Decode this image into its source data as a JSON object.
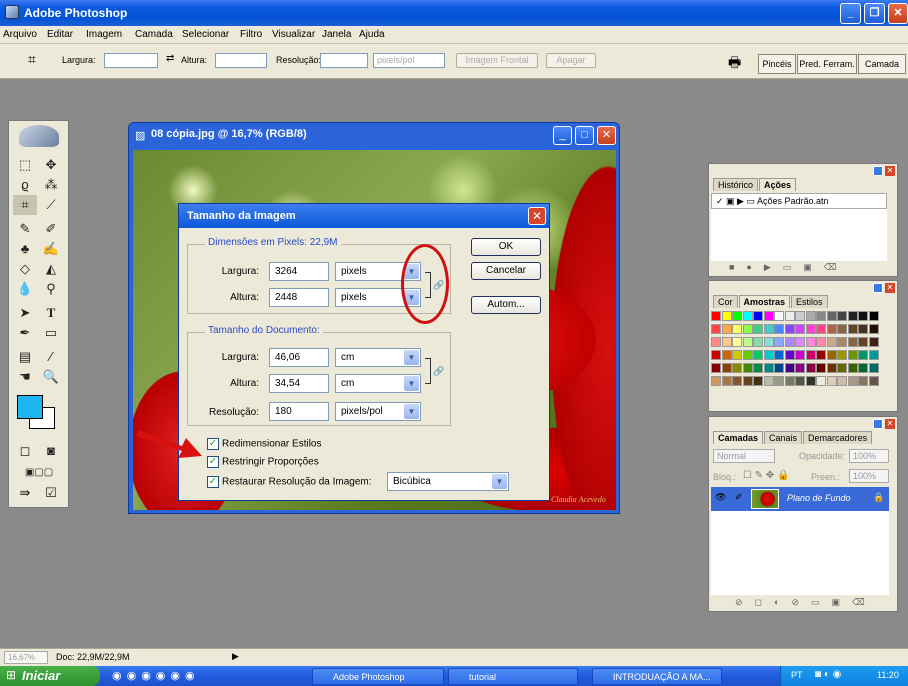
{
  "app": {
    "title": "Adobe Photoshop"
  },
  "menu": [
    "Arquivo",
    "Editar",
    "Imagem",
    "Camada",
    "Selecionar",
    "Filtro",
    "Visualizar",
    "Janela",
    "Ajuda"
  ],
  "options": {
    "largura_label": "Largura:",
    "altura_label": "Altura:",
    "resolucao_label": "Resolução:",
    "unit": "pixels/pol",
    "front_image": "Imagem Frontal",
    "clear": "Apagar",
    "tabs": [
      "Pincéis",
      "Pred. Ferram.",
      "Camada"
    ]
  },
  "document": {
    "title": "08 cópia.jpg @ 16,7% (RGB/8)",
    "watermark": "Claudia Acevedo"
  },
  "dialog": {
    "title": "Tamanho da Imagem",
    "pixel_dims_label": "Dimensões em Pixels: 22,9M",
    "doc_size_label": "Tamanho do Documento:",
    "px_width_label": "Largura:",
    "px_width": "3264",
    "px_width_unit": "pixels",
    "px_height_label": "Altura:",
    "px_height": "2448",
    "px_height_unit": "pixels",
    "doc_width_label": "Largura:",
    "doc_width": "46,06",
    "doc_width_unit": "cm",
    "doc_height_label": "Altura:",
    "doc_height": "34,54",
    "doc_height_unit": "cm",
    "resolution_label": "Resolução:",
    "resolution": "180",
    "resolution_unit": "pixels/pol",
    "ok": "OK",
    "cancel": "Cancelar",
    "auto": "Autom...",
    "chk_scale_styles": "Redimensionar Estilos",
    "chk_constrain": "Restringir Proporções",
    "chk_resample": "Restaurar Resolução da Imagem:",
    "resample_method": "Bicúbica"
  },
  "actions_panel": {
    "tabs": [
      "Histórico",
      "Ações"
    ],
    "item": "Ações Padrão.atn"
  },
  "swatches_panel": {
    "tabs": [
      "Cor",
      "Amostras",
      "Estilos"
    ]
  },
  "layers_panel": {
    "tabs": [
      "Camadas",
      "Canais",
      "Demarcadores"
    ],
    "blend": "Normal",
    "opacity_label": "Opacidade:",
    "opacity": "100%",
    "lock_label": "Bloq.:",
    "fill_label": "Preen.:",
    "fill": "100%",
    "layer_name": "Plano de Fundo"
  },
  "status": {
    "zoom": "16,67%",
    "doc": "Doc: 22,9M/22,9M"
  },
  "taskbar": {
    "start": "Iniciar",
    "tasks": [
      "Adobe Photoshop",
      "tutorial",
      "INTRODUAÇÃO A MA..."
    ],
    "lang": "PT",
    "clock": "11:20"
  },
  "colors": {
    "accent": "#0a58d8",
    "highlight_circle": "#d01010",
    "swatch_fg": "#1eb4f0"
  }
}
